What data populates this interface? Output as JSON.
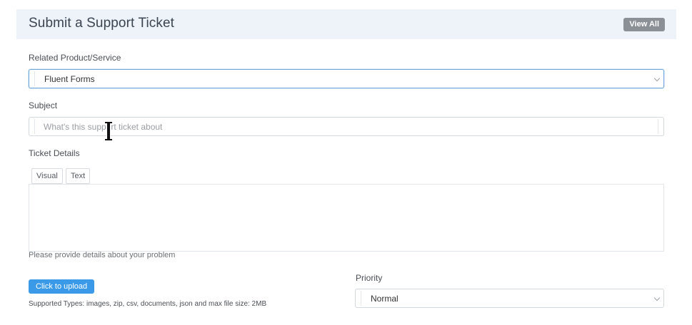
{
  "header": {
    "title": "Submit a Support Ticket",
    "view_all_label": "View All"
  },
  "product": {
    "label": "Related Product/Service",
    "selected": "Fluent Forms",
    "icon": "chevron-down-icon"
  },
  "subject": {
    "label": "Subject",
    "placeholder": "What's this support ticket about",
    "value": ""
  },
  "details": {
    "label": "Ticket Details",
    "tabs": [
      {
        "label": "Visual"
      },
      {
        "label": "Text"
      }
    ],
    "help": "Please provide details about your problem"
  },
  "upload": {
    "button_label": "Click to upload",
    "supported": "Supported Types: images, zip, csv, documents, json and max file size: 2MB"
  },
  "priority": {
    "label": "Priority",
    "selected": "Normal",
    "icon": "chevron-down-icon"
  },
  "colors": {
    "header_bg": "#eef3f9",
    "accent": "#3a9ae8",
    "view_all_bg": "#8b9096",
    "focus_border": "#6fa8dc"
  }
}
